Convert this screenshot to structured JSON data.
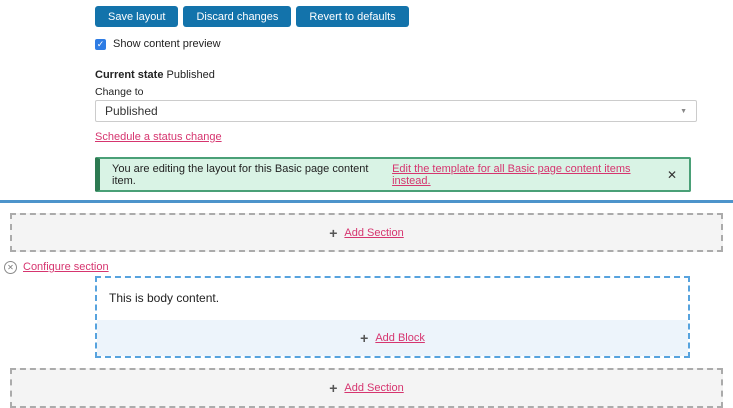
{
  "toolbar": {
    "save": "Save layout",
    "discard": "Discard changes",
    "revert": "Revert to defaults"
  },
  "preview": {
    "label": "Show content preview",
    "checked": true,
    "check_icon": "✓"
  },
  "moderation": {
    "current_state_label": "Current state",
    "current_state_value": "Published",
    "change_to_label": "Change to",
    "selected_state": "Published",
    "chevron_icon": "▼",
    "schedule_link": "Schedule a status change"
  },
  "banner": {
    "message": "You are editing the layout for this Basic page content item.",
    "link": "Edit the template for all Basic page content items instead.",
    "close_icon": "✕"
  },
  "sections": {
    "plus_icon": "+",
    "add_section_top": "Add Section",
    "remove_icon": "✕",
    "configure_link": "Configure section",
    "body_text": "This is body content.",
    "add_block": "Add Block",
    "add_section_bottom": "Add Section"
  },
  "colors": {
    "button_blue": "#1373ab",
    "checkbox_blue": "#2e7ce4",
    "link_pink": "#d6356f",
    "banner_bg": "#d9f3e5",
    "banner_border": "#4aa077",
    "banner_border_left": "#2d7a52",
    "divider_blue": "#4d94cb",
    "section_border_blue": "#57a3de",
    "add_block_bg": "#edf4fb",
    "add_section_bg": "#f4f4f4",
    "add_section_border": "#ababab"
  }
}
